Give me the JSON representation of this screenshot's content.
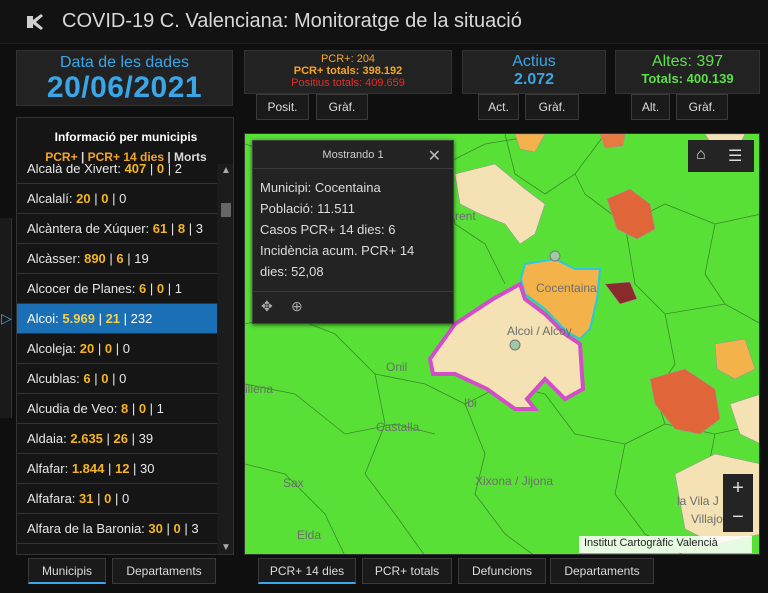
{
  "header": {
    "title": "COVID-19 C. Valenciana: Monitoratge de la situació",
    "logo_icon": "virus-icon"
  },
  "date": {
    "label": "Data de les dades",
    "value": "20/06/2021"
  },
  "pcr": {
    "line1": "PCR+: 204",
    "line2": "PCR+ totals: 398.192",
    "line3": "Positius totals: 409.659"
  },
  "actius": {
    "label": "Actius",
    "value": "2.072"
  },
  "altes": {
    "line1": "Altes: 397",
    "line2": "Totals: 400.139"
  },
  "tabs_top": {
    "posit": "Posit.",
    "graf1": "Gràf.",
    "act": "Act.",
    "graf2": "Gràf.",
    "alt": "Alt.",
    "graf3": "Gràf."
  },
  "list": {
    "title": "Informació per municipis",
    "sub_pcr": "PCR+",
    "sub_sep1": " | ",
    "sub_pcr14": "PCR+ 14 dies",
    "sub_sep2": " | ",
    "sub_morts": "Morts",
    "items": [
      {
        "name": "Alcalà de Xivert:",
        "a": "407",
        "b": "0",
        "c": "2"
      },
      {
        "name": "Alcalalí:",
        "a": "20",
        "b": "0",
        "c": "0"
      },
      {
        "name": "Alcàntera de Xúquer:",
        "a": "61",
        "b": "8",
        "c": "3"
      },
      {
        "name": "Alcàsser:",
        "a": "890",
        "b": "6",
        "c": "19"
      },
      {
        "name": "Alcocer de Planes:",
        "a": "6",
        "b": "0",
        "c": "1"
      },
      {
        "name": "Alcoi:",
        "a": "5.969",
        "b": "21",
        "c": "232"
      },
      {
        "name": "Alcoleja:",
        "a": "20",
        "b": "0",
        "c": "0"
      },
      {
        "name": "Alcublas:",
        "a": "6",
        "b": "0",
        "c": "0"
      },
      {
        "name": "Alcudia de Veo:",
        "a": "8",
        "b": "0",
        "c": "1"
      },
      {
        "name": "Aldaia:",
        "a": "2.635",
        "b": "26",
        "c": "39"
      },
      {
        "name": "Alfafar:",
        "a": "1.844",
        "b": "12",
        "c": "30"
      },
      {
        "name": "Alfafara:",
        "a": "31",
        "b": "0",
        "c": "0"
      },
      {
        "name": "Alfara de la Baronia:",
        "a": "30",
        "b": "0",
        "c": "3"
      }
    ],
    "sep": " | "
  },
  "tabs_bottom_left": {
    "municipis": "Municipis",
    "departaments": "Departaments"
  },
  "tabs_bottom_map": {
    "pcr14": "PCR+ 14 dies",
    "pcrtot": "PCR+ totals",
    "defuncions": "Defuncions",
    "departaments": "Departaments"
  },
  "popup": {
    "header": "Mostrando 1",
    "municipi": "Municipi: Cocentaina",
    "poblacio": "Població: 11.511",
    "casos": "Casos PCR+ 14 dies: 6",
    "incidencia1": "Incidència acum. PCR+ 14",
    "incidencia2": "dies: 52,08"
  },
  "map": {
    "labels": {
      "cocentaina": "Cocentaina",
      "alcoi": "Alcoi / Alcoy",
      "onil": "Onil",
      "ibi": "Ibi",
      "castalla": "Castalla",
      "sax": "Sax",
      "xixona": "Xixona / Jijona",
      "elda": "Elda",
      "villena": "illena",
      "vilajoyosa1": "la Vila J",
      "vilajoyosa2": "Villajo",
      "ontinyent": "rent"
    },
    "attribution": "Institut Cartogràfic Valencià",
    "zoom_in": "+",
    "zoom_out": "−"
  },
  "colors": {
    "accent": "#3aa6e8",
    "green": "#58e036",
    "orange": "#f5a623",
    "red": "#e0302a"
  }
}
